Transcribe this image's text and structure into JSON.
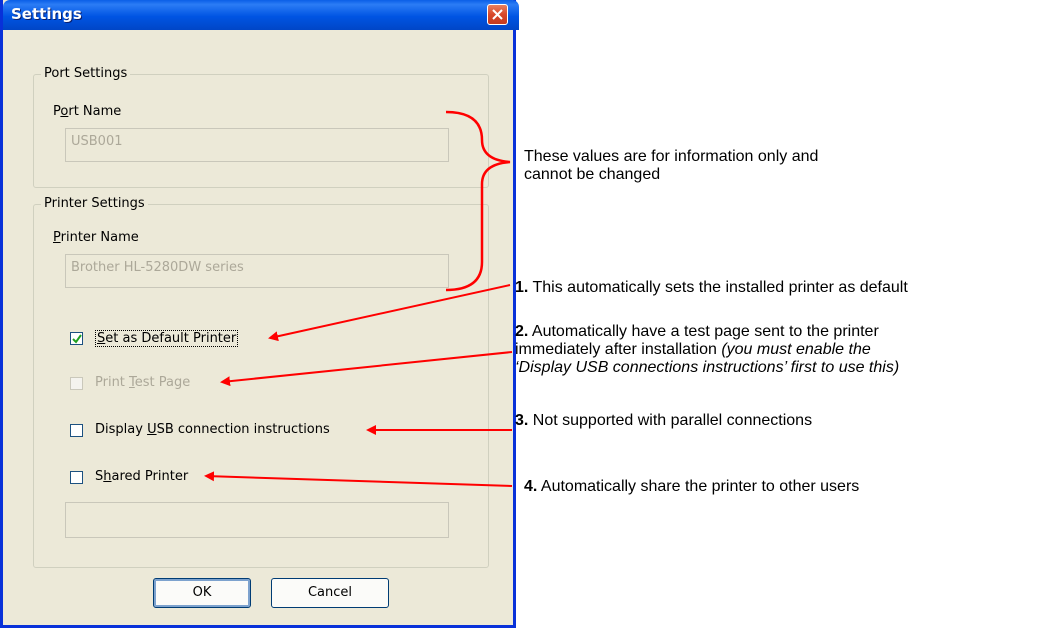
{
  "dialog": {
    "title": "Settings",
    "port_group_label": "Port Settings",
    "port_name_label_pre": "P",
    "port_name_label_u": "o",
    "port_name_label_post": "rt Name",
    "port_name_value": "USB001",
    "printer_group_label": "Printer Settings",
    "printer_name_label_u": "P",
    "printer_name_label_post": "rinter Name",
    "printer_name_value": "Brother HL-5280DW series",
    "checkboxes": [
      {
        "pre": "",
        "u": "S",
        "post": "et as Default Printer",
        "checked": true,
        "enabled": true
      },
      {
        "pre": "Print ",
        "u": "T",
        "post": "est Page",
        "checked": false,
        "enabled": false
      },
      {
        "pre": "Display ",
        "u": "U",
        "post": "SB connection instructions",
        "checked": false,
        "enabled": true
      },
      {
        "pre": "S",
        "u": "h",
        "post": "ared Printer",
        "checked": false,
        "enabled": true
      }
    ],
    "share_name_value": "",
    "ok_label": "OK",
    "cancel_label": "Cancel"
  },
  "annotations": {
    "info_line1": "These values are for information only and",
    "info_line2": "cannot be changed",
    "note1_num": "1.",
    "note1_text": " This automatically sets the installed printer as default",
    "note2_num": "2.",
    "note2_text": " Automatically have a test page sent to the printer",
    "note2_line2": "immediately after installation ",
    "note2_line2_italic": "(you must enable the",
    "note2_line3_italic": "‘Display USB connections instructions’ first to use this)",
    "note3_num": "3.",
    "note3_text": " Not supported with parallel connections",
    "note4_num": "4.",
    "note4_text": " Automatically share the printer to other users"
  },
  "colors": {
    "arrow": "#ff0000",
    "titlebar": "#0054e3",
    "dialog_bg": "#ece9d8"
  }
}
